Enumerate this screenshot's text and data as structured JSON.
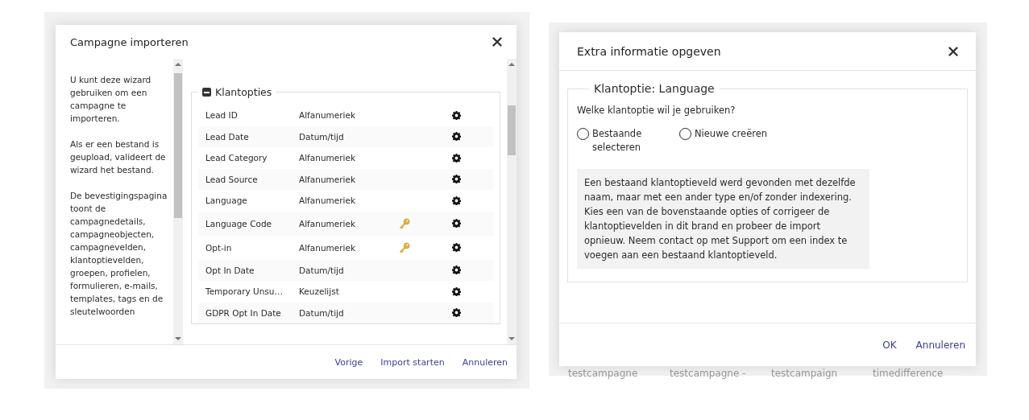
{
  "import_dialog": {
    "title": "Campagne importeren",
    "help_paragraphs": [
      "U kunt deze wizard gebruiken om een campagne te importeren.",
      "Als er een bestand is geupload, valideert de wizard het bestand.",
      "De bevestigingspagina toont de campagnedetails, campagneobjecten, campagnevelden, klantoptievelden, groepen, profielen, formulieren, e-mails, templates, tags en de sleutelwoorden"
    ],
    "section": {
      "title": "Klantopties",
      "expanded": true,
      "rows": [
        {
          "name": "Lead ID",
          "type": "Alfanumeriek",
          "key": false
        },
        {
          "name": "Lead Date",
          "type": "Datum/tijd",
          "key": false
        },
        {
          "name": "Lead Category",
          "type": "Alfanumeriek",
          "key": false
        },
        {
          "name": "Lead Source",
          "type": "Alfanumeriek",
          "key": false
        },
        {
          "name": "Language",
          "type": "Alfanumeriek",
          "key": false
        },
        {
          "name": "Language Code",
          "type": "Alfanumeriek",
          "key": true
        },
        {
          "name": "Opt-in",
          "type": "Alfanumeriek",
          "key": true
        },
        {
          "name": "Opt In Date",
          "type": "Datum/tijd",
          "key": false
        },
        {
          "name": "Temporary Unsu…",
          "type": "Keuzelijst",
          "key": false
        },
        {
          "name": "GDPR Opt In Date",
          "type": "Datum/tijd",
          "key": false
        }
      ]
    },
    "buttons": [
      "Vorige",
      "Import starten",
      "Annuleren"
    ]
  },
  "extra_dialog": {
    "background_row": [
      "testcampagne",
      "testcampagne -",
      "testcampaign",
      "timedifference"
    ],
    "title": "Extra informatie opgeven",
    "legend": "Klantoptie: Language",
    "question": "Welke klantoptie wil je gebruiken?",
    "options": [
      {
        "label": "Bestaande selecteren",
        "selected": false
      },
      {
        "label": "Nieuwe creëren",
        "selected": false
      }
    ],
    "message": "Een bestaand klantoptieveld werd gevonden met dezelfde naam, maar met een ander type en/of zonder indexering. Kies een van de bovenstaande opties of corrigeer de klantoptievelden in dit brand en probeer de import opnieuw. Neem contact op met Support om een index te voegen aan een bestaand klantoptieveld.",
    "buttons": [
      "OK",
      "Annuleren"
    ]
  }
}
